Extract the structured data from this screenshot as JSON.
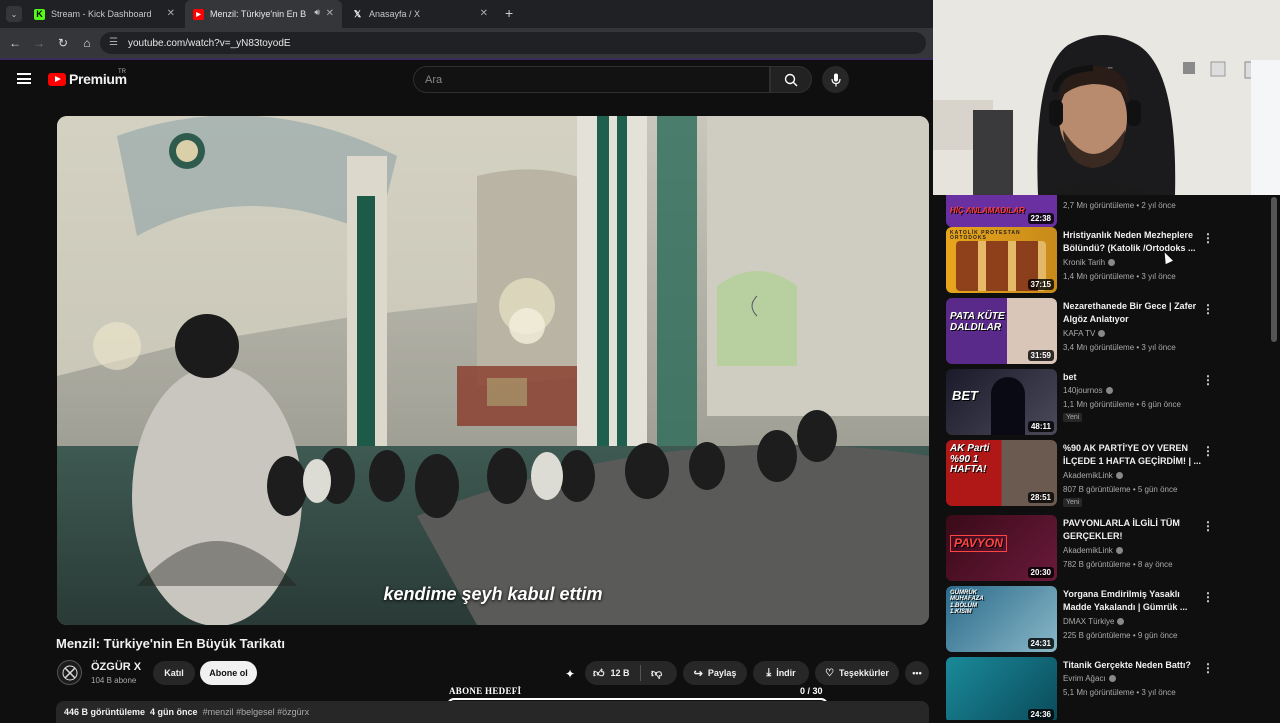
{
  "browser": {
    "tabs": [
      {
        "label": "Stream - Kick Dashboard",
        "favicon": "K"
      },
      {
        "label": "Menzil: Türkiye'nin En Büyük",
        "favicon": "▶"
      },
      {
        "label": "Anasayfa / X",
        "favicon": "𝕏"
      }
    ],
    "new_tab": "+",
    "url": "youtube.com/watch?v=_yN83toyodE"
  },
  "youtube": {
    "logo_text": "Premium",
    "logo_region": "TR",
    "search_placeholder": "Ara"
  },
  "video": {
    "subtitle": "kendime şeyh kabul ettim",
    "title": "Menzil: Türkiye'nin En Büyük Tarikatı",
    "channel": "ÖZGÜR X",
    "subscribers": "104 B abone",
    "join_label": "Katıl",
    "subscribe_label": "Abone ol",
    "likes": "12 B",
    "share_label": "Paylaş",
    "download_label": "İndir",
    "thanks_label": "Teşekkürler",
    "views": "446 B görüntüleme",
    "date": "4 gün önce",
    "tags": "#menzil #belgesel #özgürx"
  },
  "goal": {
    "label": "ABONE HEDEFİ",
    "count": "0 / 30",
    "progress": 0
  },
  "recommendations": [
    {
      "title": "",
      "thumb_caption": "HİÇ ANLAMADILAR",
      "channel": "",
      "meta": "2,7 Mn görüntüleme • 2 yıl önce",
      "duration": "22:38",
      "color": "#6a2fa0",
      "new": ""
    },
    {
      "title": "Hristiyanlık Neden Mezheplere Bölündü? (Katolik /Ortodoks ...",
      "thumb_caption": "KATOLİK PROTESTAN ORTODOKS",
      "channel": "Kronik Tarih",
      "meta": "1,4 Mn görüntüleme • 3 yıl önce",
      "duration": "37:15",
      "color": "#e8a51c",
      "new": ""
    },
    {
      "title": "Nezarethanede Bir Gece | Zafer Algöz Anlatıyor",
      "thumb_caption": "PATA KÜTE DALDILAR",
      "channel": "KAFA TV",
      "meta": "3,4 Mn görüntüleme • 3 yıl önce",
      "duration": "31:59",
      "color": "#5a2a8a",
      "new": ""
    },
    {
      "title": "bet",
      "thumb_caption": "BET",
      "channel": "140journos",
      "meta": "1,1 Mn görüntüleme • 6 gün önce",
      "duration": "48:11",
      "color": "#2a2a3a",
      "new": "Yeni"
    },
    {
      "title": "%90 AK PARTİ'YE OY VEREN İLÇEDE 1 HAFTA GEÇİRDİM! | ...",
      "thumb_caption": "AK Parti %90 1 HAFTA!",
      "channel": "AkademikLink",
      "meta": "807 B görüntüleme • 5 gün önce",
      "duration": "28:51",
      "color": "#b01818",
      "new": "Yeni"
    },
    {
      "title": "PAVYONLARLA İLGİLİ TÜM GERÇEKLER!",
      "thumb_caption": "PAVYON",
      "channel": "AkademikLink",
      "meta": "782 B görüntüleme • 8 ay önce",
      "duration": "20:30",
      "color": "#3a0a18",
      "new": ""
    },
    {
      "title": "Yorgana Emdirilmiş Yasaklı Madde Yakalandı | Gümrük ...",
      "thumb_caption": "GÜMRÜK MUHAFAZA 1.BÖLÜM 1.KISIM",
      "channel": "DMAX Türkiye",
      "meta": "225 B görüntüleme • 9 gün önce",
      "duration": "24:31",
      "color": "#2a6a8a",
      "new": ""
    },
    {
      "title": "Titanik Gerçekte Neden Battı?",
      "thumb_caption": "",
      "channel": "Evrim Ağacı",
      "meta": "5,1 Mn görüntüleme • 3 yıl önce",
      "duration": "24:36",
      "color": "#1a8a9a",
      "new": ""
    }
  ]
}
